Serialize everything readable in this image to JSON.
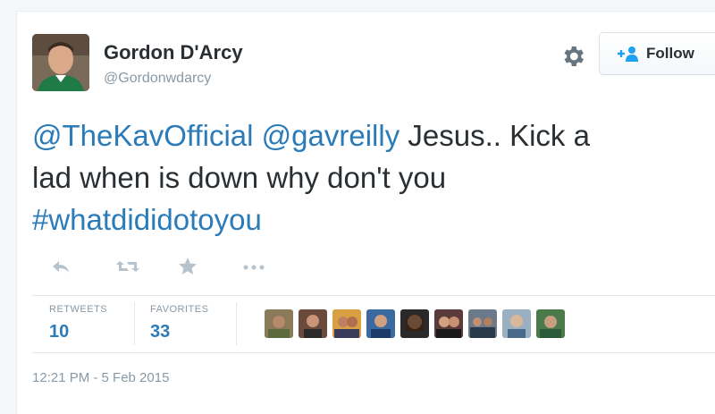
{
  "user": {
    "name": "Gordon D'Arcy",
    "handle": "@Gordonwdarcy"
  },
  "follow_label": "Follow",
  "tweet": {
    "mention1": "@TheKavOfficial",
    "mention2": "@gavreilly",
    "text_line1_rest": " Jesus.. Kick a",
    "text_line2": "lad when is down why don't you",
    "hashtag": "#whatdididotoyou"
  },
  "actions": {
    "reply": "reply-icon",
    "retweet": "retweet-icon",
    "favorite": "star-icon",
    "more": "more-icon"
  },
  "stats": {
    "retweets_label": "RETWEETS",
    "retweets_count": "10",
    "favorites_label": "FAVORITES",
    "favorites_count": "33"
  },
  "favoriters_count": 9,
  "timestamp": "12:21 PM - 5 Feb 2015",
  "colors": {
    "link": "#2b7bb9",
    "text": "#292f33",
    "muted": "#8899a6",
    "border": "#e1e8ed"
  }
}
